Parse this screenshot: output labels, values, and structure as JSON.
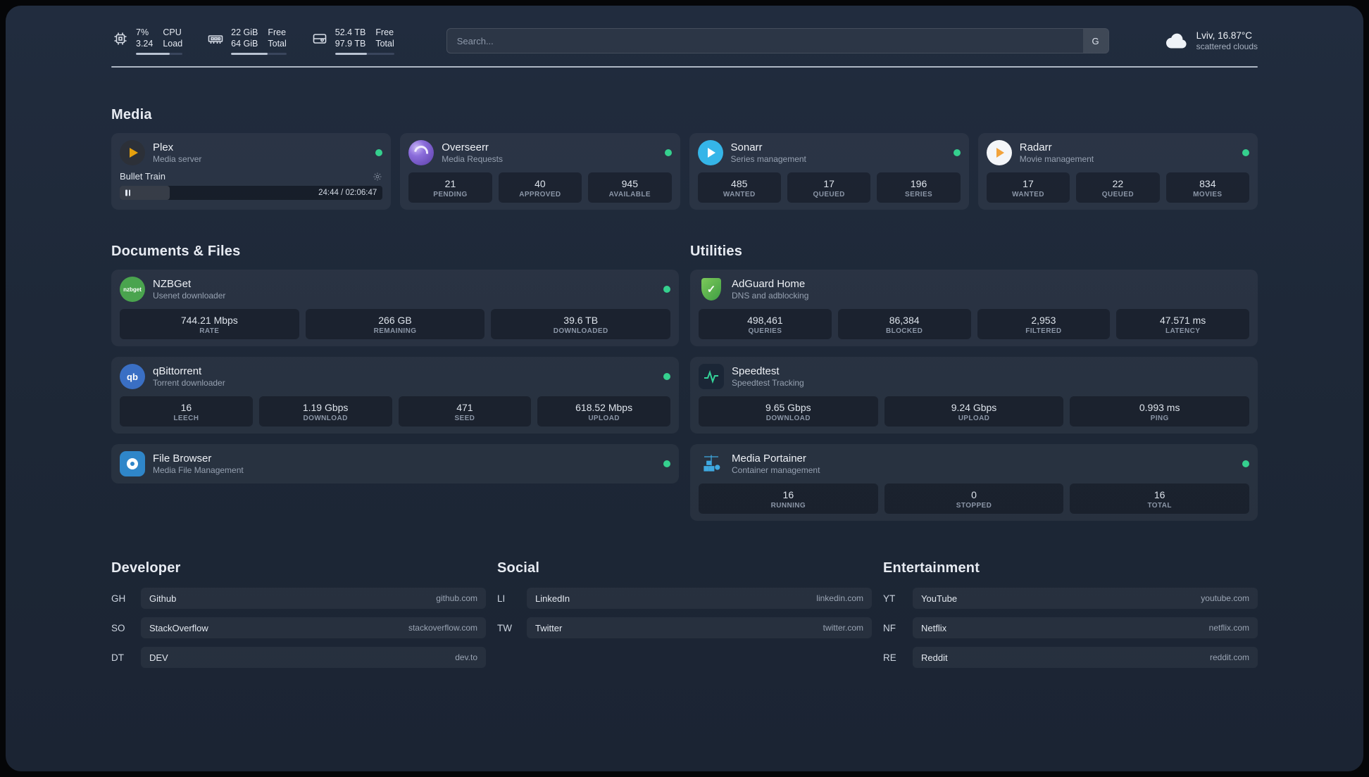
{
  "theme": {
    "background": "#1d2736",
    "card": "#2a3345",
    "status_online": "#35d08e",
    "plex_amber": "#e5a00d",
    "speedtest_green": "#34d399"
  },
  "topbar": {
    "cpu": {
      "value1": "7%",
      "value2": "3.24",
      "label1": "CPU",
      "label2": "Load"
    },
    "memory": {
      "value1": "22 GiB",
      "value2": "64 GiB",
      "label1": "Free",
      "label2": "Total"
    },
    "disk": {
      "value1": "52.4 TB",
      "value2": "97.9 TB",
      "label1": "Free",
      "label2": "Total"
    },
    "search": {
      "placeholder": "Search...",
      "button": "G"
    },
    "weather": {
      "location": "Lviv, 16.87°C",
      "condition": "scattered clouds"
    }
  },
  "media": {
    "title": "Media",
    "plex": {
      "name": "Plex",
      "subtitle": "Media server",
      "now_playing": "Bullet Train",
      "time": "24:44 / 02:06:47"
    },
    "overseerr": {
      "name": "Overseerr",
      "subtitle": "Media Requests",
      "stats": [
        {
          "value": "21",
          "label": "PENDING"
        },
        {
          "value": "40",
          "label": "APPROVED"
        },
        {
          "value": "945",
          "label": "AVAILABLE"
        }
      ]
    },
    "sonarr": {
      "name": "Sonarr",
      "subtitle": "Series management",
      "stats": [
        {
          "value": "485",
          "label": "WANTED"
        },
        {
          "value": "17",
          "label": "QUEUED"
        },
        {
          "value": "196",
          "label": "SERIES"
        }
      ]
    },
    "radarr": {
      "name": "Radarr",
      "subtitle": "Movie management",
      "stats": [
        {
          "value": "17",
          "label": "WANTED"
        },
        {
          "value": "22",
          "label": "QUEUED"
        },
        {
          "value": "834",
          "label": "MOVIES"
        }
      ]
    }
  },
  "documents": {
    "title": "Documents & Files",
    "nzbget": {
      "name": "NZBGet",
      "subtitle": "Usenet downloader",
      "icon_text": "nzbget",
      "stats": [
        {
          "value": "744.21 Mbps",
          "label": "RATE"
        },
        {
          "value": "266 GB",
          "label": "REMAINING"
        },
        {
          "value": "39.6 TB",
          "label": "DOWNLOADED"
        }
      ]
    },
    "qbittorrent": {
      "name": "qBittorrent",
      "subtitle": "Torrent downloader",
      "icon_text": "qb",
      "stats": [
        {
          "value": "16",
          "label": "LEECH"
        },
        {
          "value": "1.19 Gbps",
          "label": "DOWNLOAD"
        },
        {
          "value": "471",
          "label": "SEED"
        },
        {
          "value": "618.52 Mbps",
          "label": "UPLOAD"
        }
      ]
    },
    "filebrowser": {
      "name": "File Browser",
      "subtitle": "Media File Management"
    }
  },
  "utilities": {
    "title": "Utilities",
    "adguard": {
      "name": "AdGuard Home",
      "subtitle": "DNS and adblocking",
      "icon_check": "✓",
      "stats": [
        {
          "value": "498,461",
          "label": "QUERIES"
        },
        {
          "value": "86,384",
          "label": "BLOCKED"
        },
        {
          "value": "2,953",
          "label": "FILTERED"
        },
        {
          "value": "47.571 ms",
          "label": "LATENCY"
        }
      ]
    },
    "speedtest": {
      "name": "Speedtest",
      "subtitle": "Speedtest Tracking",
      "stats": [
        {
          "value": "9.65 Gbps",
          "label": "DOWNLOAD"
        },
        {
          "value": "9.24 Gbps",
          "label": "UPLOAD"
        },
        {
          "value": "0.993 ms",
          "label": "PING"
        }
      ]
    },
    "portainer": {
      "name": "Media Portainer",
      "subtitle": "Container management",
      "stats": [
        {
          "value": "16",
          "label": "RUNNING"
        },
        {
          "value": "0",
          "label": "STOPPED"
        },
        {
          "value": "16",
          "label": "TOTAL"
        }
      ]
    }
  },
  "bookmarks": {
    "developer": {
      "title": "Developer",
      "items": [
        {
          "abbr": "GH",
          "name": "Github",
          "url": "github.com"
        },
        {
          "abbr": "SO",
          "name": "StackOverflow",
          "url": "stackoverflow.com"
        },
        {
          "abbr": "DT",
          "name": "DEV",
          "url": "dev.to"
        }
      ]
    },
    "social": {
      "title": "Social",
      "items": [
        {
          "abbr": "LI",
          "name": "LinkedIn",
          "url": "linkedin.com"
        },
        {
          "abbr": "TW",
          "name": "Twitter",
          "url": "twitter.com"
        }
      ]
    },
    "entertainment": {
      "title": "Entertainment",
      "items": [
        {
          "abbr": "YT",
          "name": "YouTube",
          "url": "youtube.com"
        },
        {
          "abbr": "NF",
          "name": "Netflix",
          "url": "netflix.com"
        },
        {
          "abbr": "RE",
          "name": "Reddit",
          "url": "reddit.com"
        }
      ]
    }
  }
}
